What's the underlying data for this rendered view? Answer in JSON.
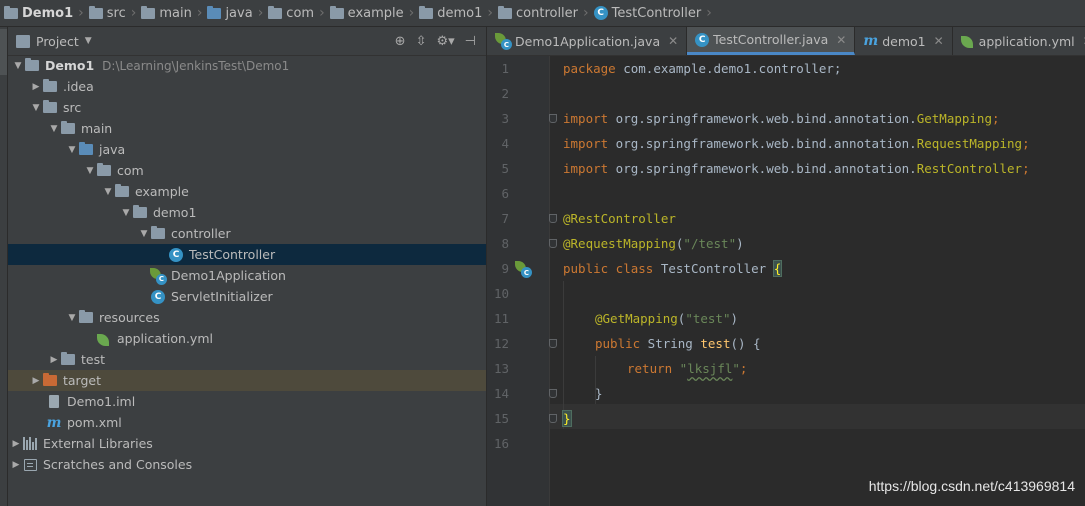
{
  "breadcrumb": [
    {
      "label": "Demo1",
      "icon": "project-folder-icon"
    },
    {
      "label": "src",
      "icon": "folder-icon"
    },
    {
      "label": "main",
      "icon": "folder-icon"
    },
    {
      "label": "java",
      "icon": "source-folder-icon"
    },
    {
      "label": "com",
      "icon": "package-icon"
    },
    {
      "label": "example",
      "icon": "package-icon"
    },
    {
      "label": "demo1",
      "icon": "package-icon"
    },
    {
      "label": "controller",
      "icon": "package-icon"
    },
    {
      "label": "TestController",
      "icon": "class-icon"
    }
  ],
  "project_panel": {
    "title": "Project",
    "tools": [
      "target-icon",
      "collapse-icon",
      "gear-icon",
      "hide-icon"
    ]
  },
  "tree": [
    {
      "label": "Demo1",
      "path": "D:\\Learning\\JenkinsTest\\Demo1",
      "icon": "project-folder-icon",
      "expanded": true
    },
    {
      "label": ".idea",
      "icon": "folder-icon",
      "expanded": false
    },
    {
      "label": "src",
      "icon": "folder-icon",
      "expanded": true
    },
    {
      "label": "main",
      "icon": "folder-icon",
      "expanded": true
    },
    {
      "label": "java",
      "icon": "source-folder-icon",
      "expanded": true
    },
    {
      "label": "com",
      "icon": "package-icon",
      "expanded": true
    },
    {
      "label": "example",
      "icon": "package-icon",
      "expanded": true
    },
    {
      "label": "demo1",
      "icon": "package-icon",
      "expanded": true
    },
    {
      "label": "controller",
      "icon": "package-icon",
      "expanded": true
    },
    {
      "label": "TestController",
      "icon": "class-icon",
      "selected": true
    },
    {
      "label": "Demo1Application",
      "icon": "spring-boot-class-icon"
    },
    {
      "label": "ServletInitializer",
      "icon": "class-icon"
    },
    {
      "label": "resources",
      "icon": "resources-folder-icon",
      "expanded": true
    },
    {
      "label": "application.yml",
      "icon": "spring-yml-icon"
    },
    {
      "label": "test",
      "icon": "folder-icon",
      "expanded": false
    },
    {
      "label": "target",
      "icon": "excluded-folder-icon",
      "expanded": false
    },
    {
      "label": "Demo1.iml",
      "icon": "module-file-icon"
    },
    {
      "label": "pom.xml",
      "icon": "maven-icon"
    },
    {
      "label": "External Libraries",
      "icon": "libraries-icon",
      "expanded": false
    },
    {
      "label": "Scratches and Consoles",
      "icon": "scratches-icon",
      "expanded": false
    }
  ],
  "tabs": [
    {
      "label": "Demo1Application.java",
      "icon": "spring-boot-class-icon",
      "active": false
    },
    {
      "label": "TestController.java",
      "icon": "class-icon",
      "active": true
    },
    {
      "label": "demo1",
      "icon": "maven-icon",
      "active": false
    },
    {
      "label": "application.yml",
      "icon": "spring-yml-icon",
      "active": false
    }
  ],
  "editor": {
    "line_numbers": [
      "1",
      "2",
      "3",
      "4",
      "5",
      "6",
      "7",
      "8",
      "9",
      "10",
      "11",
      "12",
      "13",
      "14",
      "15",
      "16"
    ],
    "code": {
      "l1_kw": "package",
      "l1_rest": " com.example.demo1.controller;",
      "l3_kw": "import",
      "l3_pkg": " org.springframework.web.bind.annotation.",
      "l3_cls": "GetMapping",
      "l3_end": ";",
      "l4_kw": "import",
      "l4_pkg": " org.springframework.web.bind.annotation.",
      "l4_cls": "RequestMapping",
      "l4_end": ";",
      "l5_kw": "import",
      "l5_pkg": " org.springframework.web.bind.annotation.",
      "l5_cls": "RestController",
      "l5_end": ";",
      "l7_ann": "@RestController",
      "l8_ann": "@RequestMapping",
      "l8_open": "(",
      "l8_str": "\"/test\"",
      "l8_close": ")",
      "l9_kw": "public class",
      "l9_name": " TestController ",
      "l9_brace": "{",
      "l11_ann": "@GetMapping",
      "l11_open": "(",
      "l11_str": "\"test\"",
      "l11_close": ")",
      "l12_kw": "public",
      "l12_type": " String ",
      "l12_fn": "test",
      "l12_rest": "() {",
      "l13_kw": "return",
      "l13_str_open": " \"",
      "l13_str_word": "lksjfl",
      "l13_str_close": "\"",
      "l13_end": ";",
      "l14_brace": "}",
      "l15_brace": "}"
    }
  },
  "watermark": "https://blog.csdn.net/c413969814"
}
